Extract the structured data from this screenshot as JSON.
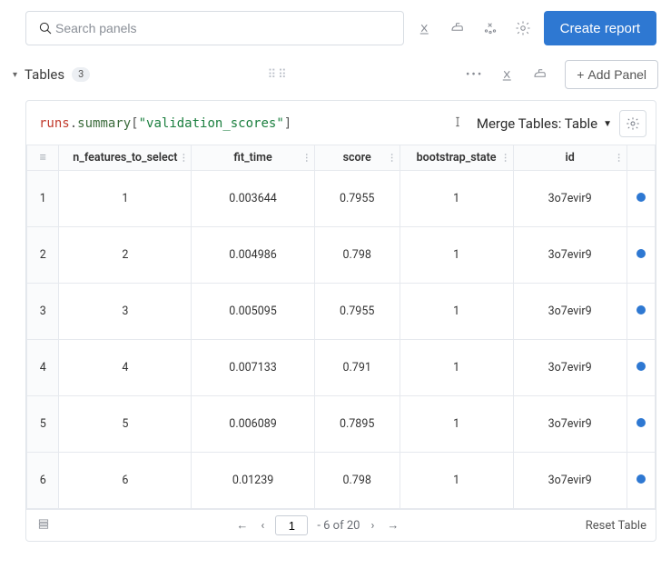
{
  "search": {
    "placeholder": "Search panels"
  },
  "header": {
    "create_report": "Create report"
  },
  "section": {
    "title": "Tables",
    "count": "3",
    "add_panel": "Add Panel"
  },
  "panel": {
    "expr": {
      "obj": "runs",
      "prop": "summary",
      "key": "\"validation_scores\""
    },
    "merge_label": "Merge Tables: Table",
    "columns": [
      "n_features_to_select",
      "fit_time",
      "score",
      "bootstrap_state",
      "id"
    ],
    "rows": [
      {
        "idx": "1",
        "n_features_to_select": "1",
        "fit_time": "0.003644",
        "score": "0.7955",
        "bootstrap_state": "1",
        "id": "3o7evir9"
      },
      {
        "idx": "2",
        "n_features_to_select": "2",
        "fit_time": "0.004986",
        "score": "0.798",
        "bootstrap_state": "1",
        "id": "3o7evir9"
      },
      {
        "idx": "3",
        "n_features_to_select": "3",
        "fit_time": "0.005095",
        "score": "0.7955",
        "bootstrap_state": "1",
        "id": "3o7evir9"
      },
      {
        "idx": "4",
        "n_features_to_select": "4",
        "fit_time": "0.007133",
        "score": "0.791",
        "bootstrap_state": "1",
        "id": "3o7evir9"
      },
      {
        "idx": "5",
        "n_features_to_select": "5",
        "fit_time": "0.006089",
        "score": "0.7895",
        "bootstrap_state": "1",
        "id": "3o7evir9"
      },
      {
        "idx": "6",
        "n_features_to_select": "6",
        "fit_time": "0.01239",
        "score": "0.798",
        "bootstrap_state": "1",
        "id": "3o7evir9"
      }
    ],
    "pager": {
      "current": "1",
      "range": "- 6 of 20"
    },
    "reset": "Reset Table"
  }
}
